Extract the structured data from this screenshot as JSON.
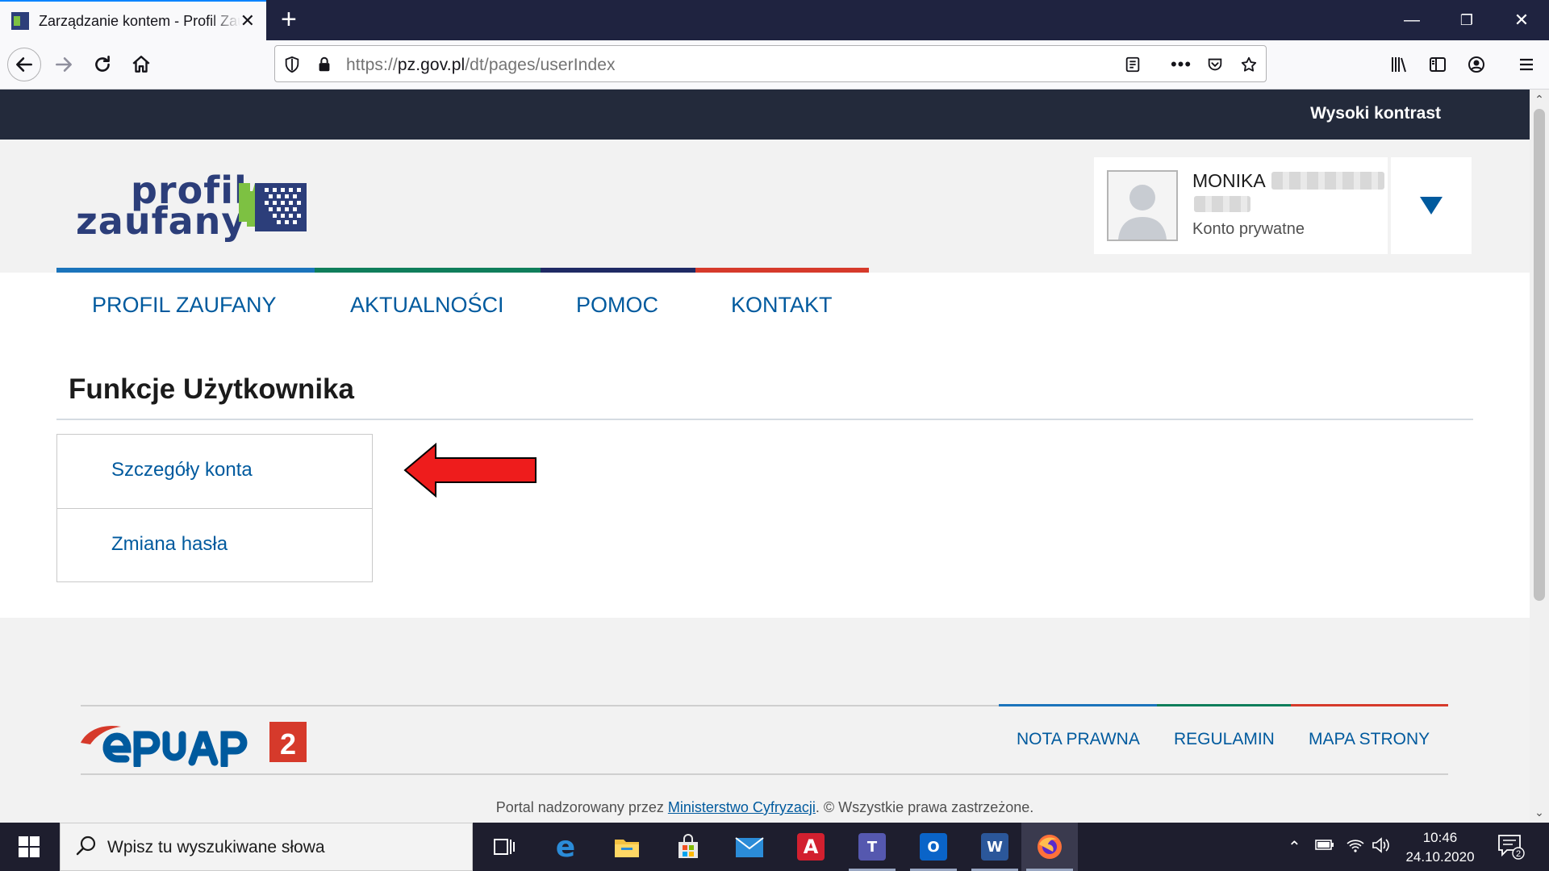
{
  "browser": {
    "tab_title": "Zarządzanie kontem - Profil Zaufany",
    "url_prefix": "https://",
    "url_host": "pz.gov.pl",
    "url_path": "/dt/pages/userIndex"
  },
  "site": {
    "high_contrast_label": "Wysoki kontrast",
    "logo_line1": "profil",
    "logo_line2": "zaufany",
    "user": {
      "name": "MONIKA",
      "account_type": "Konto prywatne"
    },
    "nav": [
      "PROFIL ZAUFANY",
      "AKTUALNOŚCI",
      "POMOC",
      "KONTAKT"
    ],
    "section_title": "Funkcje Użytkownika",
    "menu": [
      "Szczegóły konta",
      "Zmiana hasła"
    ],
    "footer": {
      "links": [
        "NOTA PRAWNA",
        "REGULAMIN",
        "MAPA STRONY"
      ],
      "copyright_before": "Portal nadzorowany przez ",
      "copyright_link": "Ministerstwo Cyfryzacji",
      "copyright_after": ". © Wszystkie prawa zastrzeżone.",
      "epuap_badge": "2"
    },
    "colors": {
      "brand_blue": "#005a9e",
      "dark_strip": "#232a3b",
      "line_blue": "#1b74bb",
      "line_green": "#0f7e5b",
      "line_navy": "#1f2a64",
      "line_red": "#d63a2b"
    }
  },
  "taskbar": {
    "search_placeholder": "Wpisz tu wyszukiwane słowa",
    "time": "10:46",
    "date": "24.10.2020",
    "notification_count": "2",
    "apps": [
      "task-view",
      "edge",
      "file-explorer",
      "store",
      "mail",
      "ipocc",
      "teams",
      "outlook",
      "word",
      "firefox"
    ]
  }
}
